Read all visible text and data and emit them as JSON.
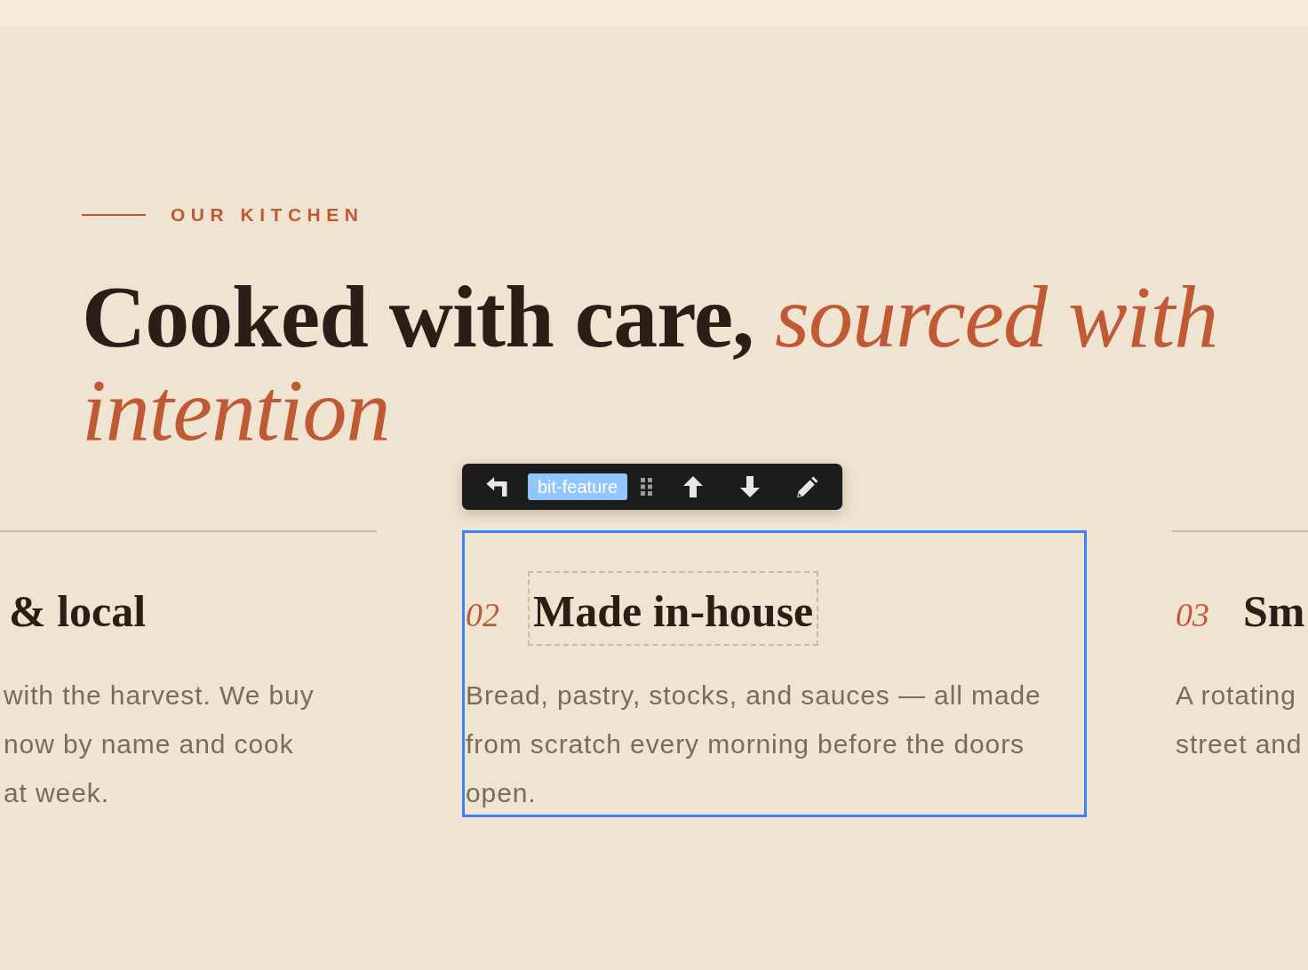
{
  "eyebrow": "OUR KITCHEN",
  "headline": "Cooked with care, *sourced with intention*",
  "toolbar": {
    "tag": "bit-feature"
  },
  "features": [
    {
      "title": "& local",
      "title_outlined": false,
      "selected": false,
      "body": [
        "with the harvest. We buy",
        "now by name and cook",
        "at week."
      ]
    },
    {
      "number": "02",
      "title": "Made in-house",
      "title_outlined": true,
      "selected": true,
      "body": [
        "Bread, pastry, stocks, and sauces — all made",
        "from scratch every morning before the doors",
        "open."
      ]
    },
    {
      "number": "03",
      "title": "Sm",
      "title_outlined": false,
      "selected": false,
      "body": [
        "A rotating",
        "street and"
      ]
    }
  ]
}
